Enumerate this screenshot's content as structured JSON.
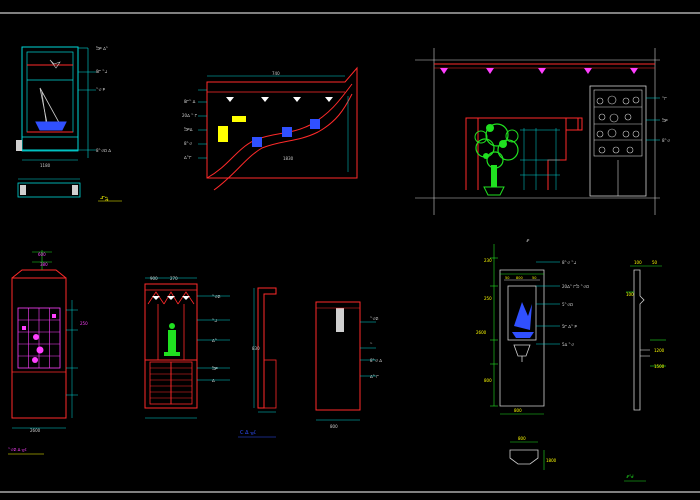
{
  "drawing": {
    "colors": {
      "background": "#000000",
      "frame": "#ffffff",
      "wall": "#ff2a2a",
      "dimension": "#00d8d8",
      "plant": "#20e020",
      "accent_magenta": "#ff40ff",
      "accent_yellow": "#ffff00",
      "accent_blue": "#3050ff",
      "neutral": "#d0d0d0"
    },
    "title_1": "ᖹᖸ᪘",
    "title_4": "ᓐᜏᕠ ᐃ ᚗᦷ",
    "title_5": "C ᐃ ᚗᦷ",
    "title_7": "ᕵᖁ",
    "dims": {
      "d1": "1180",
      "d2": "740",
      "d3": "1830",
      "d4": "600",
      "d5": "380",
      "d6": "250",
      "d7": "2600",
      "d8": "900",
      "d9": "270",
      "d10": "830",
      "d11": "800",
      "d12": "230",
      "d13": "50",
      "d14": "100",
      "d15": "1200",
      "d16": "1500",
      "d17": "2600",
      "d18": "800",
      "d19": "800",
      "d20": "1800"
    },
    "notes": {
      "n1": "ᘸᖴ ᐃᓐ",
      "n2": "8ᖸ ᓐᖹ",
      "n3": "ᓐᜏ ᖴ",
      "n4": "8ᓐᜏᕠ ᐃ",
      "n5": "8ᖸᓐ ᐃ",
      "n6": "20ᐃ ᓐ ᖸ",
      "n7": "ᘸᖴᐃ",
      "n8": "8ᓐᜏ",
      "n9": "ᐃᓐᖸ",
      "n10": "ᓐᖸ",
      "n11": "ᘸᖴ",
      "n12": "8ᓐᜏ",
      "n13": "ᓐᜏᕠ",
      "n14": "ᓐᖹ",
      "n15": "ᐃᓐ",
      "n16": "ᘸᖴ",
      "n17": "ᐃ",
      "n18": "ᓐᜏᕠ",
      "n19": "ᓐ",
      "n20": "8ᓐᜏ ᐃ",
      "n21": "ᐃᓐ ᖸ",
      "n22": "ᓐ",
      "n23": "ᘸᖴ ᐃ",
      "n24": "ᓐ",
      "n25": "ᓐᜏ",
      "n26": "ᕵ",
      "n27": "8ᓐᜏ ᓐᖹ",
      "n28": "20ᐃᓐ ᖸᘸ ᓐᜏᕠ",
      "n29": "5ᓐᜏᕠ",
      "n30": "5ᖸ ᐃᓐ ᖴ",
      "n31": "5ᐃ ᓐᜏ",
      "n32": "ᓐ ᖸ",
      "n33": "ᐃᓐ",
      "n34": "ᘸᖴ"
    }
  }
}
